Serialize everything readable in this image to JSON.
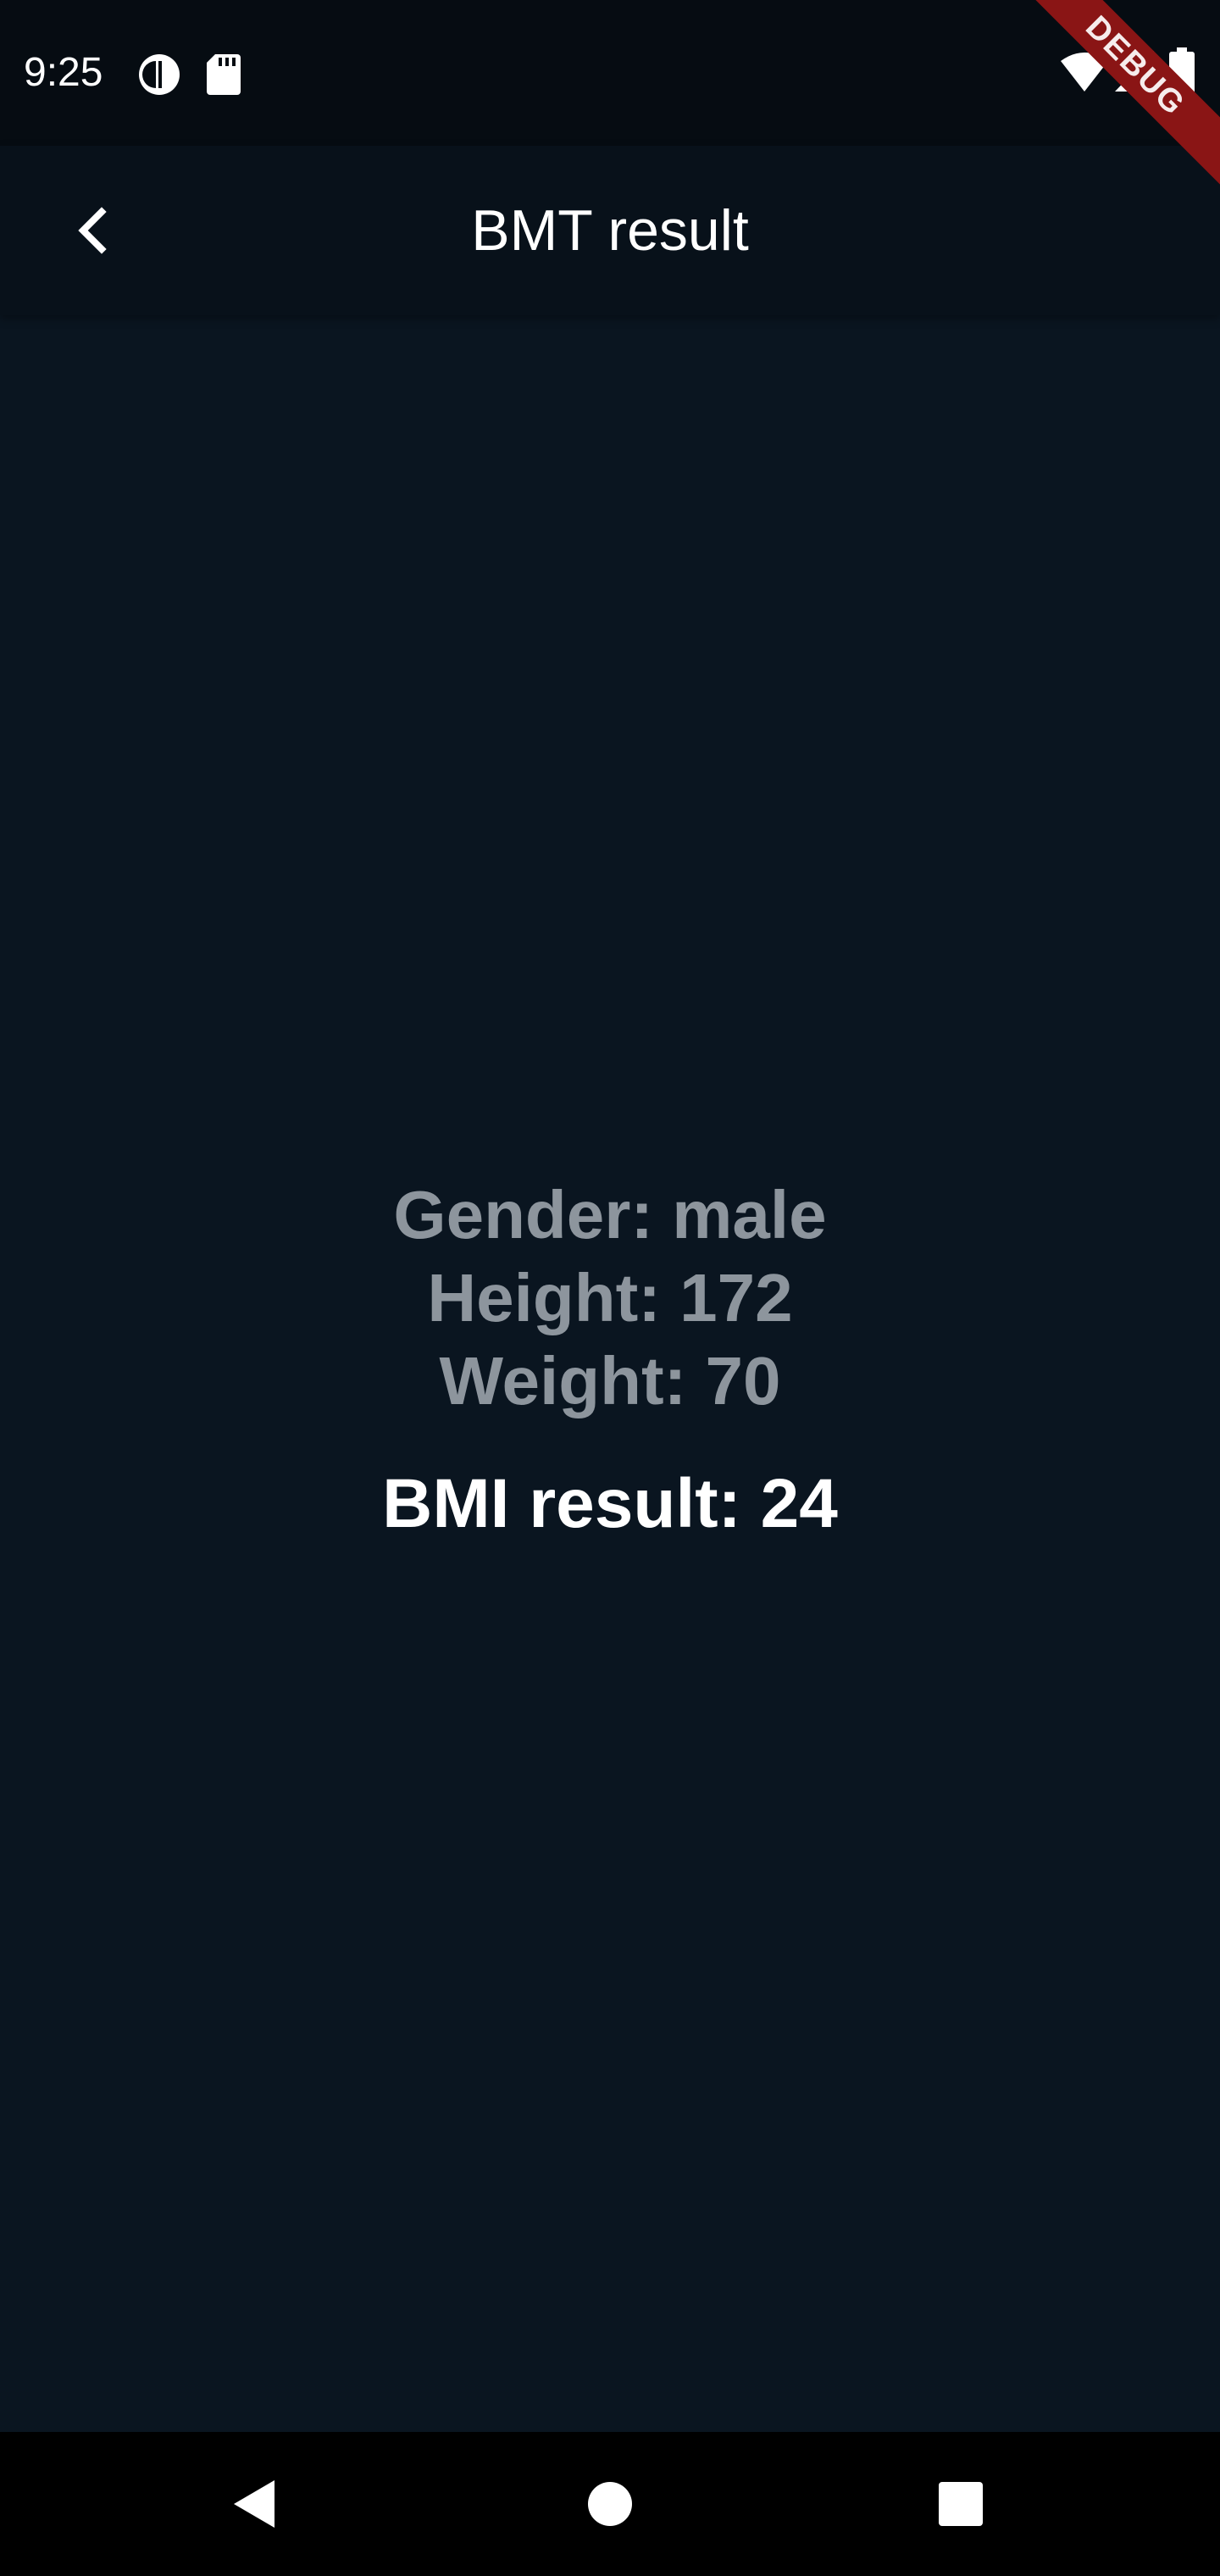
{
  "status_bar": {
    "time": "9:25",
    "icons": [
      "data-saver-icon",
      "sd-card-icon",
      "wifi-icon",
      "signal-icon",
      "battery-icon"
    ]
  },
  "debug_banner": "DEBUG",
  "app_bar": {
    "title": "BMT result",
    "back_icon": "chevron-left-icon"
  },
  "result": {
    "gender_line": "Gender: male",
    "height_line": "Height: 172",
    "weight_line": "Weight: 70",
    "bmi_line": "BMI result: 24"
  },
  "nav_bar": {
    "icons": [
      "back-triangle-icon",
      "home-circle-icon",
      "recents-square-icon"
    ]
  },
  "colors": {
    "background": "#0a1520",
    "app_bar": "#08111a",
    "muted_text": "#8d959d",
    "text": "#ffffff",
    "debug_banner": "#8a1515"
  }
}
